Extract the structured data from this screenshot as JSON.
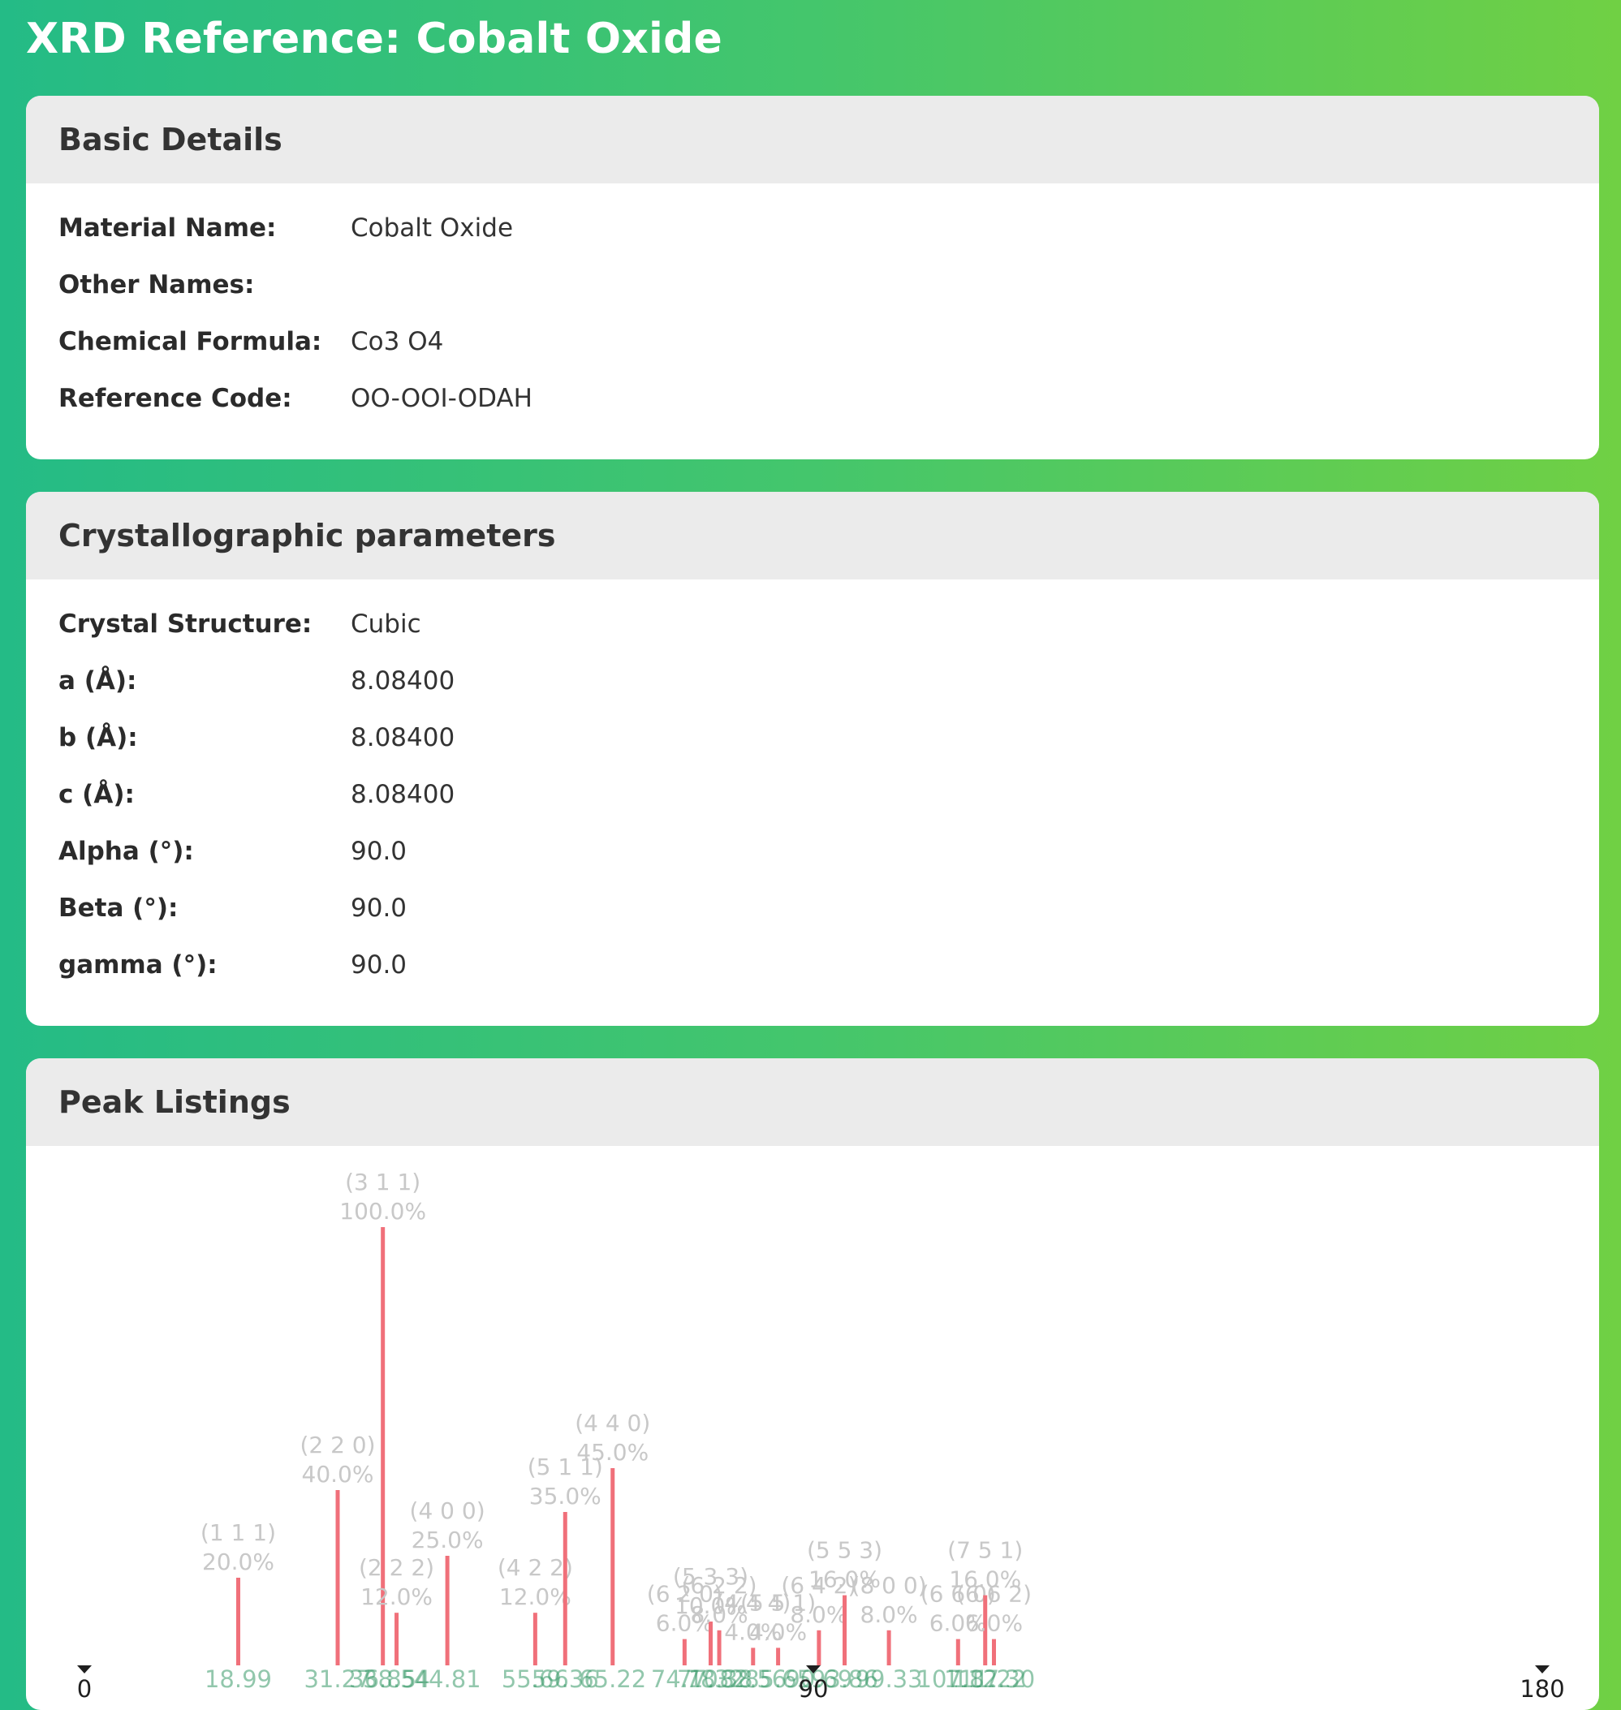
{
  "page": {
    "title": "XRD Reference: Cobalt Oxide"
  },
  "basic": {
    "title": "Basic Details",
    "rows": [
      {
        "label": "Material Name:",
        "value": "Cobalt Oxide"
      },
      {
        "label": "Other Names:",
        "value": ""
      },
      {
        "label": "Chemical Formula:",
        "value": "Co3 O4"
      },
      {
        "label": "Reference Code:",
        "value": "OO-OOI-ODAH"
      }
    ]
  },
  "crystal": {
    "title": "Crystallographic parameters",
    "rows": [
      {
        "label": "Crystal Structure:",
        "value": "Cubic"
      },
      {
        "label": "a (Å):",
        "value": "8.08400"
      },
      {
        "label": "b (Å):",
        "value": "8.08400"
      },
      {
        "label": "c (Å):",
        "value": "8.08400"
      },
      {
        "label": "Alpha (°):",
        "value": "90.0"
      },
      {
        "label": "Beta (°):",
        "value": "90.0"
      },
      {
        "label": "gamma (°):",
        "value": "90.0"
      }
    ]
  },
  "peaks": {
    "title": "Peak Listings"
  },
  "colors": {
    "bar": "#f0707a",
    "header_bg": "#ebebeb"
  },
  "chart_data": {
    "type": "bar",
    "xlim": [
      0,
      180
    ],
    "ylim": [
      0,
      100
    ],
    "x_ticks": [
      "0",
      "90",
      "180"
    ],
    "peaks": [
      {
        "x": 18.99,
        "label": "18.99",
        "hkl": "(1 1 1)",
        "intensity": 20.0,
        "intensity_label": "20.0%"
      },
      {
        "x": 31.27,
        "label": "31.27",
        "hkl": "(2 2 0)",
        "intensity": 40.0,
        "intensity_label": "40.0%"
      },
      {
        "x": 36.85,
        "label": "36.85",
        "hkl": "(3 1 1)",
        "intensity": 100.0,
        "intensity_label": "100.0%"
      },
      {
        "x": 38.54,
        "label": "38.54",
        "hkl": "(2 2 2)",
        "intensity": 12.0,
        "intensity_label": "12.0%"
      },
      {
        "x": 44.81,
        "label": "44.81",
        "hkl": "(4 0 0)",
        "intensity": 25.0,
        "intensity_label": "25.0%"
      },
      {
        "x": 55.66,
        "label": "55.66",
        "hkl": "(4 2 2)",
        "intensity": 12.0,
        "intensity_label": "12.0%"
      },
      {
        "x": 59.36,
        "label": "59.36",
        "hkl": "(5 1 1)",
        "intensity": 35.0,
        "intensity_label": "35.0%"
      },
      {
        "x": 65.22,
        "label": "65.22",
        "hkl": "(4 4 0)",
        "intensity": 45.0,
        "intensity_label": "45.0%"
      },
      {
        "x": 74.1,
        "label": "74.10",
        "hkl": "(6 2 0)",
        "intensity": 6.0,
        "intensity_label": "6.0%"
      },
      {
        "x": 77.32,
        "label": "77.32",
        "hkl": "(5 3 3)",
        "intensity": 10.0,
        "intensity_label": "10.0%"
      },
      {
        "x": 78.38,
        "label": "78.38",
        "hkl": "(6 2 2)",
        "intensity": 8.0,
        "intensity_label": "8.0%"
      },
      {
        "x": 82.56,
        "label": "82.56",
        "hkl": "(4 4 4)",
        "intensity": 4.0,
        "intensity_label": "4.0%"
      },
      {
        "x": 85.65,
        "label": "85.65",
        "hkl": "(5 5 1)",
        "intensity": 4.0,
        "intensity_label": "4.0%"
      },
      {
        "x": 90.69,
        "label": "90.69",
        "hkl": "(6 4 2)",
        "intensity": 8.0,
        "intensity_label": "8.0%"
      },
      {
        "x": 93.86,
        "label": "93.86",
        "hkl": "(5 5 3)",
        "intensity": 16.0,
        "intensity_label": "16.0%"
      },
      {
        "x": 99.33,
        "label": "99.33",
        "hkl": "(8 0 0)",
        "intensity": 8.0,
        "intensity_label": "8.0%"
      },
      {
        "x": 107.87,
        "label": "107.87",
        "hkl": "(6 6 0)",
        "intensity": 6.0,
        "intensity_label": "6.0%"
      },
      {
        "x": 111.22,
        "label": "111.22",
        "hkl": "(7 5 1)",
        "intensity": 16.0,
        "intensity_label": "16.0%"
      },
      {
        "x": 112.3,
        "label": "112.30",
        "hkl": "(6 6 2)",
        "intensity": 6.0,
        "intensity_label": "6.0%"
      }
    ]
  }
}
